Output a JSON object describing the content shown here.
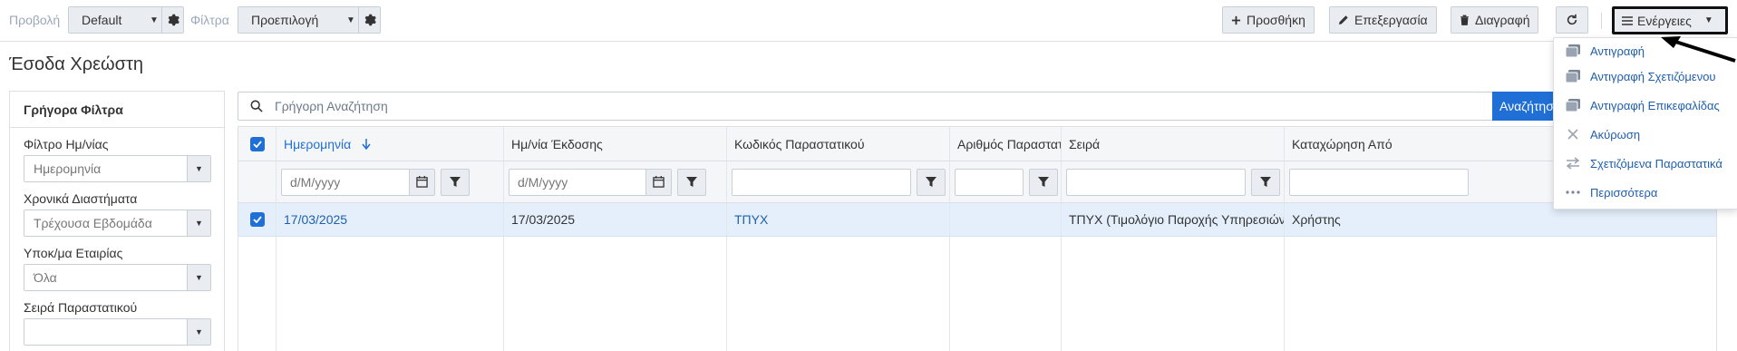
{
  "toolbar": {
    "view_label": "Προβολή",
    "view_value": "Default",
    "filter_label": "Φίλτρα",
    "filter_value": "Προεπιλογή",
    "add_label": "Προσθήκη",
    "edit_label": "Επεξεργασία",
    "delete_label": "Διαγραφή",
    "actions_label": "Ενέργειες"
  },
  "page": {
    "title": "Έσοδα Χρεώστη"
  },
  "sidebar": {
    "title": "Γρήγορα Φίλτρα",
    "filters": [
      {
        "label": "Φίλτρο Ημ/νίας",
        "value": "Ημερομηνία"
      },
      {
        "label": "Χρονικά Διαστήματα",
        "value": "Τρέχουσα Εβδομάδα"
      },
      {
        "label": "Υποκ/μα Εταιρίας",
        "value": "Όλα"
      },
      {
        "label": "Σειρά Παραστατικού",
        "value": ""
      }
    ]
  },
  "search": {
    "placeholder": "Γρήγορη Αναζήτηση",
    "button_label": "Αναζήτηση"
  },
  "grid": {
    "columns": [
      "Ημερομηνία",
      "Ημ/νία Έκδοσης",
      "Κωδικός Παραστατικού",
      "Αριθμός Παραστατ...",
      "Σειρά",
      "Καταχώρηση Από"
    ],
    "date_placeholder": "d/M/yyyy",
    "rows": [
      {
        "date": "17/03/2025",
        "issue_date": "17/03/2025",
        "doc_code": "ΤΠΥΧ",
        "doc_number": "",
        "series": "ΤΠΥΧ (Τιμολόγιο Παροχής Υπηρεσιών Εσό...",
        "created_by": "Χρήστης"
      }
    ]
  },
  "actions_menu": {
    "items": [
      {
        "label": "Αντιγραφή",
        "icon": "copy-icon"
      },
      {
        "label": "Αντιγραφή Σχετιζόμενου",
        "icon": "copy-icon"
      },
      {
        "label": "Αντιγραφή Επικεφαλίδας",
        "icon": "copy-icon"
      },
      {
        "label": "Ακύρωση",
        "icon": "close-icon"
      },
      {
        "label": "Σχετιζόμενα Παραστατικά",
        "icon": "swap-icon"
      },
      {
        "label": "Περισσότερα",
        "icon": "ellipsis-icon"
      }
    ]
  },
  "colors": {
    "accent": "#1f6fd6",
    "link": "#1f5fae",
    "selected_row": "#e4effb",
    "button_bg": "#e9edf1"
  }
}
